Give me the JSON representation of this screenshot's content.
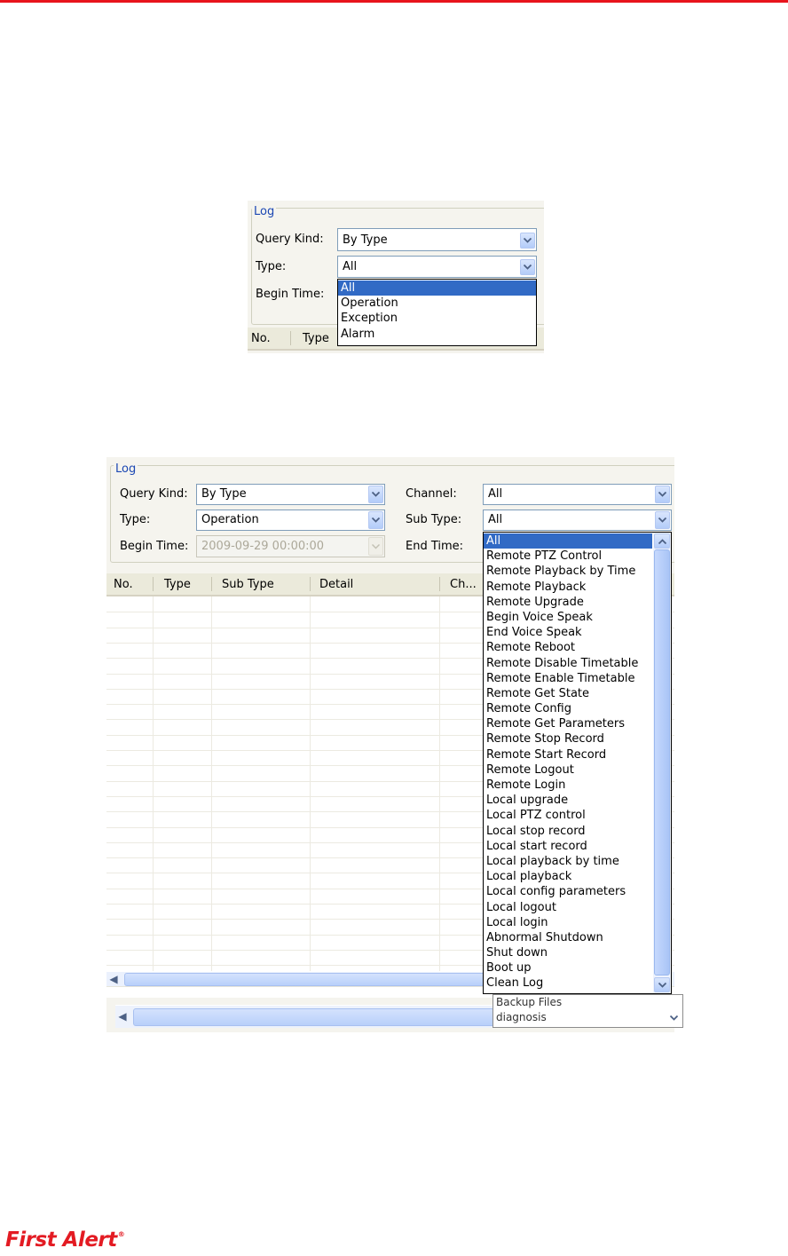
{
  "screenshot1": {
    "group_title": "Log",
    "query_kind_label": "Query Kind:",
    "query_kind_value": "By Type",
    "type_label": "Type:",
    "type_value": "All",
    "begin_time_label": "Begin Time:",
    "type_options": [
      "All",
      "Operation",
      "Exception",
      "Alarm"
    ],
    "selected_type_index": 0,
    "columns": [
      "No.",
      "Type"
    ]
  },
  "screenshot2": {
    "group_title": "Log",
    "query_kind_label": "Query Kind:",
    "query_kind_value": "By Type",
    "type_label": "Type:",
    "type_value": "Operation",
    "begin_time_label": "Begin Time:",
    "begin_time_value": "2009-09-29 00:00:00",
    "channel_label": "Channel:",
    "channel_value": "All",
    "sub_type_label": "Sub Type:",
    "sub_type_value": "All",
    "end_time_label": "End Time:",
    "columns": [
      "No.",
      "Type",
      "Sub Type",
      "Detail",
      "Ch..."
    ],
    "sub_type_options": [
      "All",
      "Remote PTZ Control",
      "Remote Playback by Time",
      "Remote Playback",
      "Remote Upgrade",
      "Begin Voice Speak",
      "End Voice Speak",
      "Remote Reboot",
      "Remote Disable Timetable",
      "Remote Enable Timetable",
      "Remote Get State",
      "Remote Config",
      "Remote Get Parameters",
      "Remote Stop Record",
      "Remote Start Record",
      "Remote Logout",
      "Remote Login",
      "Local upgrade",
      "Local PTZ control",
      "Local stop record",
      "Local start record",
      "Local playback by time",
      "Local playback",
      "Local config parameters",
      "Local logout",
      "Local login",
      "Abnormal Shutdown",
      "Shut down",
      "Boot up",
      "Clean Log"
    ],
    "selected_sub_type_index": 0,
    "extra_list_items": [
      "Backup Files",
      "diagnosis"
    ]
  },
  "logo": {
    "text": "First Alert",
    "mark": "®"
  },
  "colors": {
    "accent_red": "#e31b23",
    "selection_blue": "#316ac5",
    "group_title_blue": "#1b47b3"
  }
}
